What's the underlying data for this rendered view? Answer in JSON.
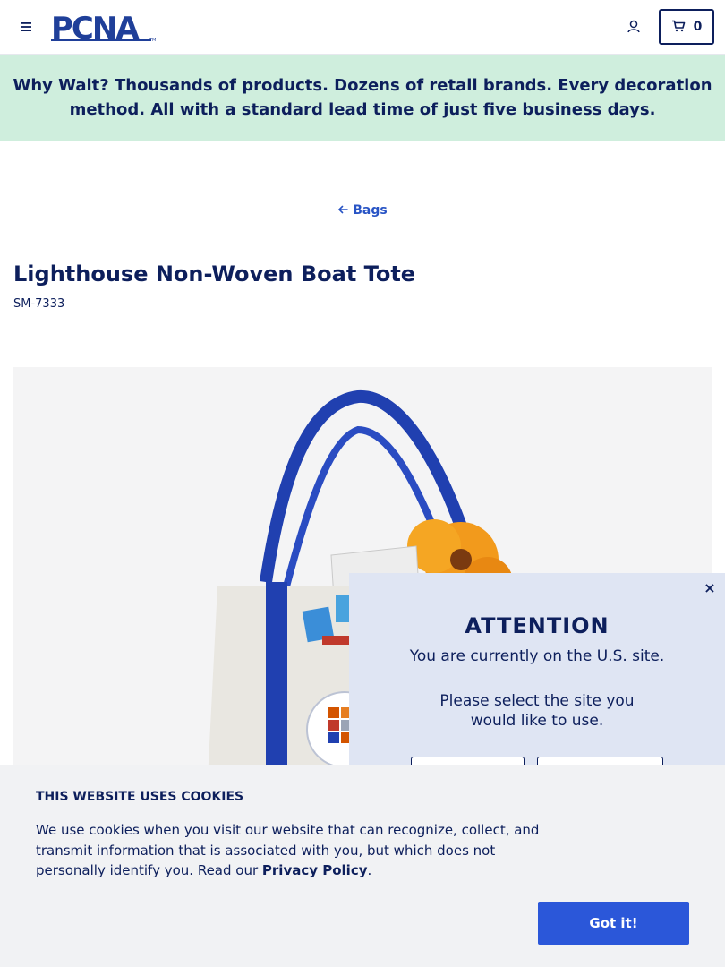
{
  "header": {
    "logo_text": "PCNA",
    "cart_count": "0",
    "colors": {
      "navy": "#0d1f5c",
      "brand_blue": "#1f3f99"
    }
  },
  "promo": {
    "lead": "Why Wait?",
    "text": " Thousands of products. Dozens of retail brands. Every decoration method. All with a standard lead time of just five business days.",
    "background": "#cfeedd"
  },
  "breadcrumb": {
    "label": "Bags",
    "icon": "arrow-left-icon"
  },
  "product": {
    "title": "Lighthouse Non-Woven Boat Tote",
    "sku": "SM-7333"
  },
  "popup": {
    "title": "ATTENTION",
    "line1": "You are currently on the U.S. site.",
    "line2": "Please select the site you would like to use.",
    "close": "×"
  },
  "cookie": {
    "title": "THIS WEBSITE USES COOKIES",
    "text_before": "We use cookies when you visit our website that can recognize, collect, and transmit information that is associated with you, but which does not personally identify you. Read our ",
    "link": "Privacy Policy",
    "text_after": ".",
    "button": "Got it!",
    "button_color": "#2b57d9"
  }
}
